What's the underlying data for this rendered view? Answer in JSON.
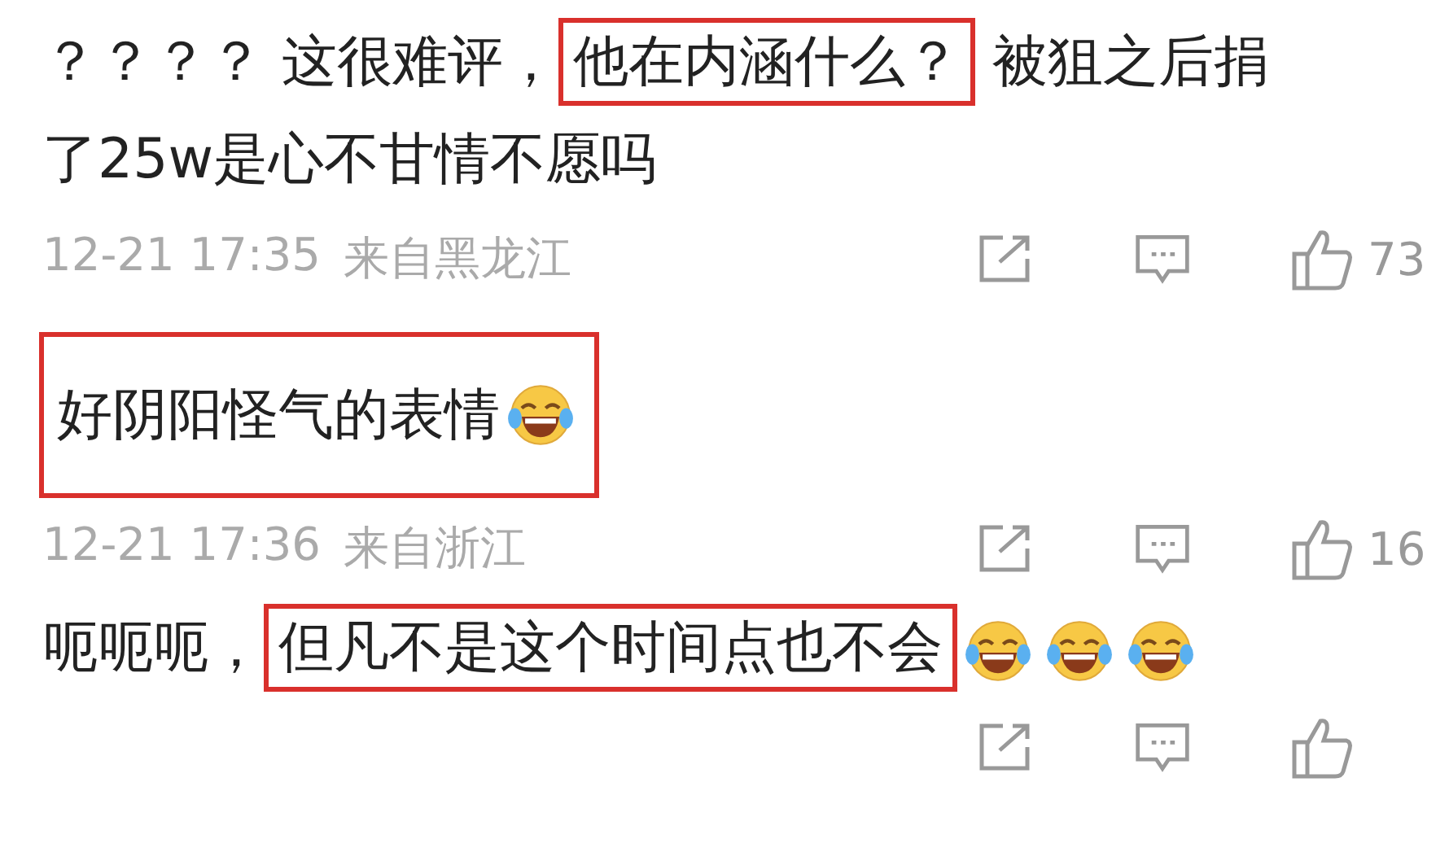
{
  "comments": [
    {
      "parts": [
        {
          "highlighted": false,
          "items": [
            {
              "kind": "text",
              "text": "？？？？ 这很难评，"
            }
          ]
        },
        {
          "highlighted": true,
          "items": [
            {
              "kind": "text",
              "text": "他在内涵什么？"
            }
          ]
        },
        {
          "highlighted": false,
          "items": [
            {
              "kind": "text",
              "text": " 被狙之后捐"
            }
          ]
        },
        {
          "highlighted": false,
          "items": [
            {
              "kind": "text",
              "text": "了25w是心不甘情不愿吗"
            }
          ]
        }
      ],
      "time": "12-21 17:35",
      "location": "来自黑龙江",
      "likes": "73"
    },
    {
      "parts": [
        {
          "highlighted": true,
          "items": [
            {
              "kind": "text",
              "text": "好阴阳怪气的表情"
            },
            {
              "kind": "emoji"
            }
          ]
        }
      ],
      "time": "12-21 17:36",
      "location": "来自浙江",
      "likes": "16"
    },
    {
      "parts": [
        {
          "highlighted": false,
          "items": [
            {
              "kind": "text",
              "text": "呃呃呃，"
            }
          ]
        },
        {
          "highlighted": true,
          "items": [
            {
              "kind": "text",
              "text": "但凡不是这个时间点也不会"
            }
          ]
        },
        {
          "highlighted": false,
          "items": [
            {
              "kind": "emoji"
            },
            {
              "kind": "emoji"
            },
            {
              "kind": "emoji"
            }
          ]
        }
      ]
    }
  ]
}
